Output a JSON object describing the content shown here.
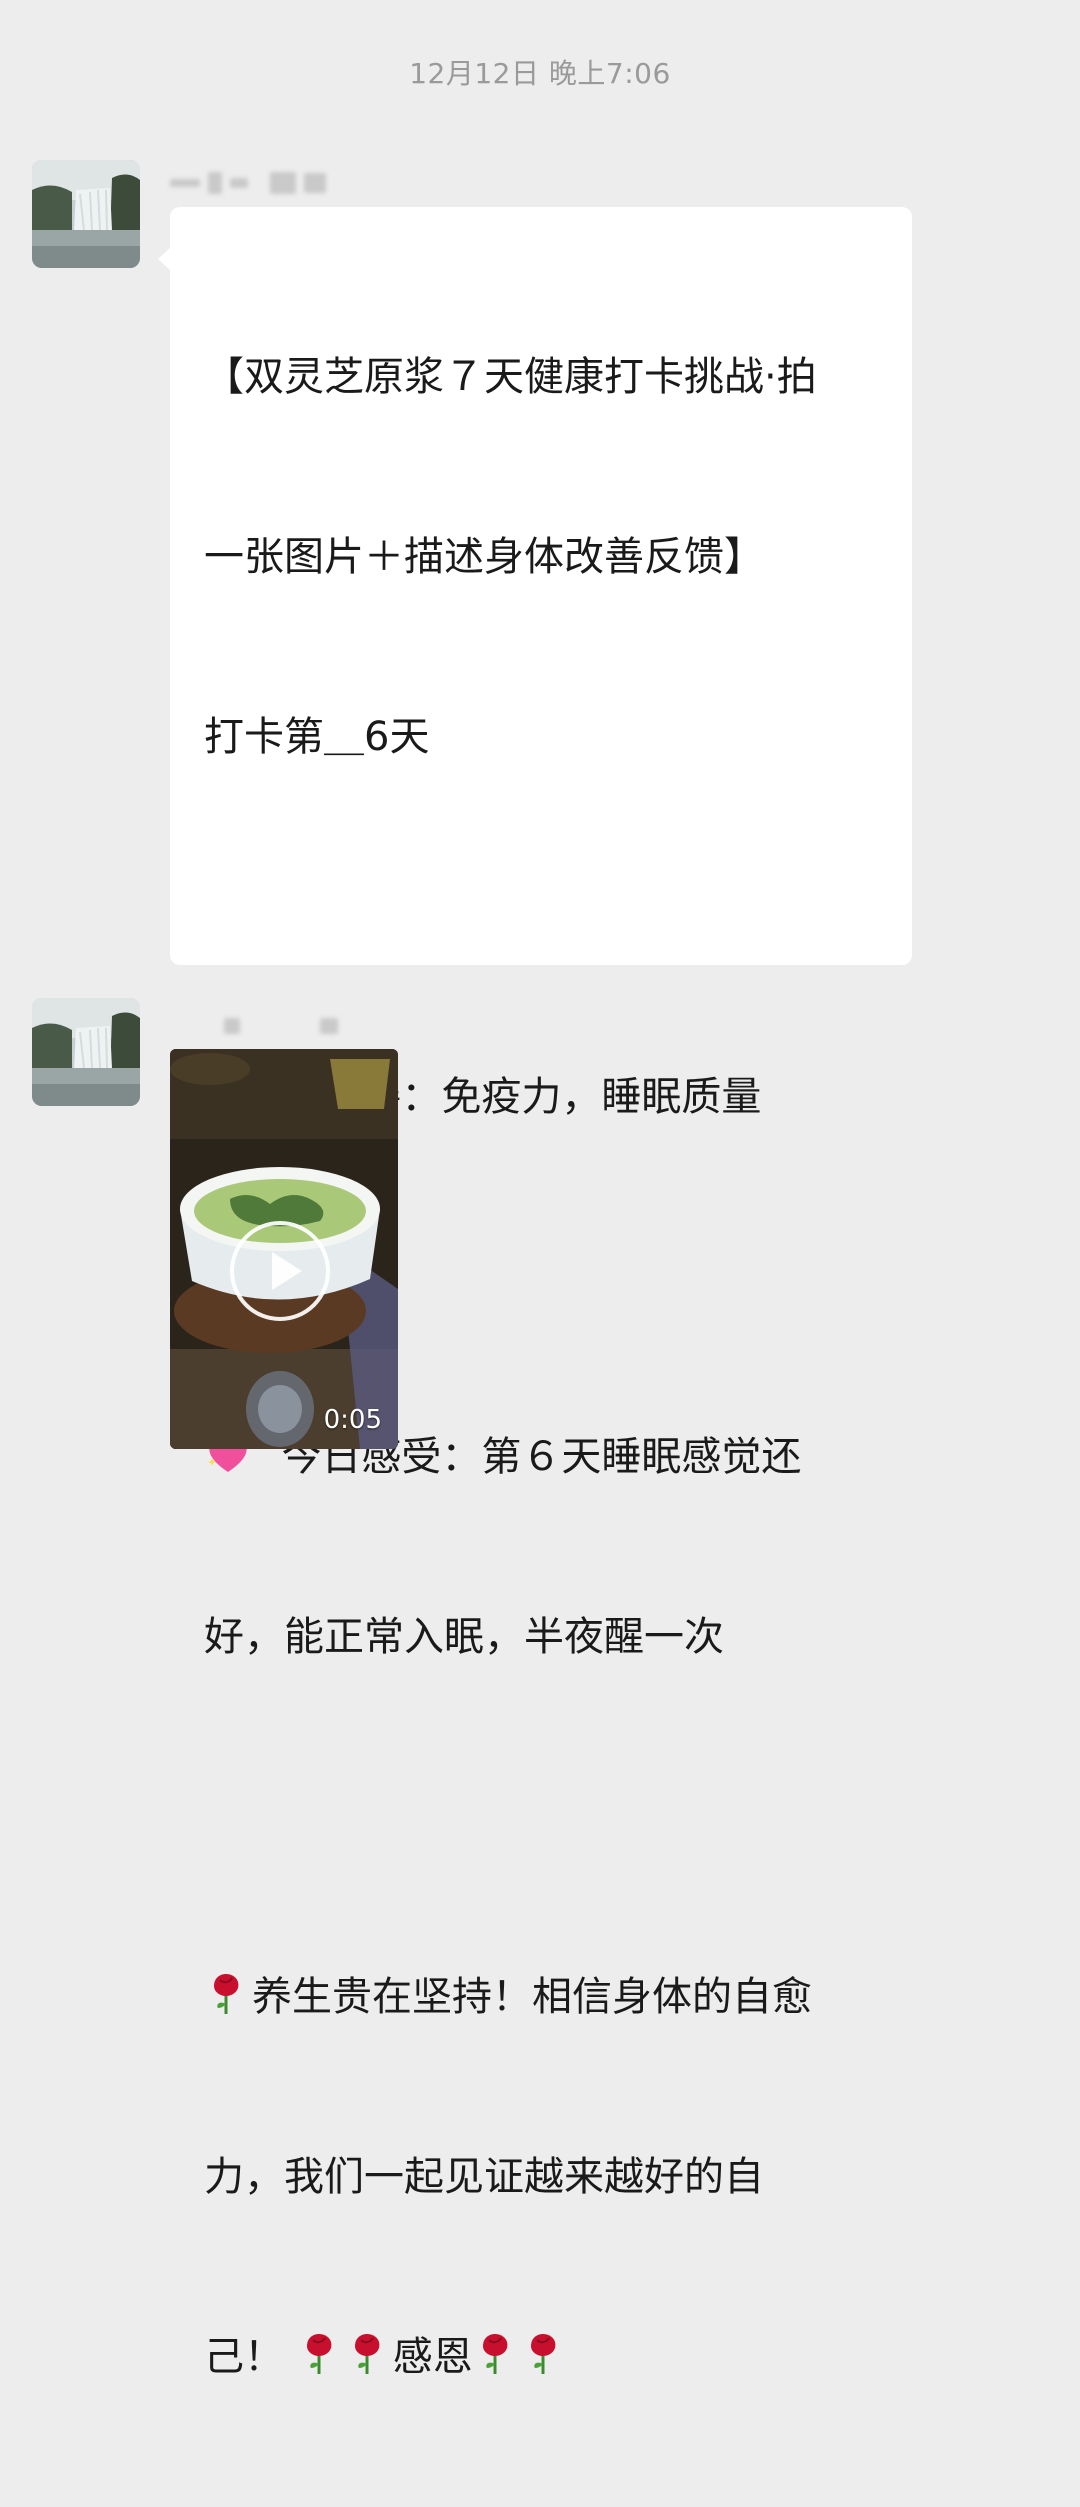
{
  "timestamp": "12月12日 晚上7:06",
  "messages": [
    {
      "type": "text",
      "avatar_icon": "waterfall-avatar-icon",
      "lines": [
        "【双灵芝原浆７天健康打卡挑战·拍",
        "一张图片＋描述身体改善反馈】",
        "打卡第＿6天",
        "",
        "想改善：免疫力，睡眠质量",
        "",
        "今日感受：第６天睡眠感觉还",
        "好，能正常入眠，半夜醒一次",
        "",
        "养生贵在坚持！相信身体的自愈",
        "力，我们一起见证越来越好的自",
        "己！",
        "感恩"
      ]
    },
    {
      "type": "video",
      "avatar_icon": "waterfall-avatar-icon",
      "duration": "0:05",
      "play_icon": "play-icon"
    }
  ],
  "colors": {
    "background": "#ededed",
    "bubble": "#ffffff",
    "timestamp": "#9a9a9a"
  }
}
